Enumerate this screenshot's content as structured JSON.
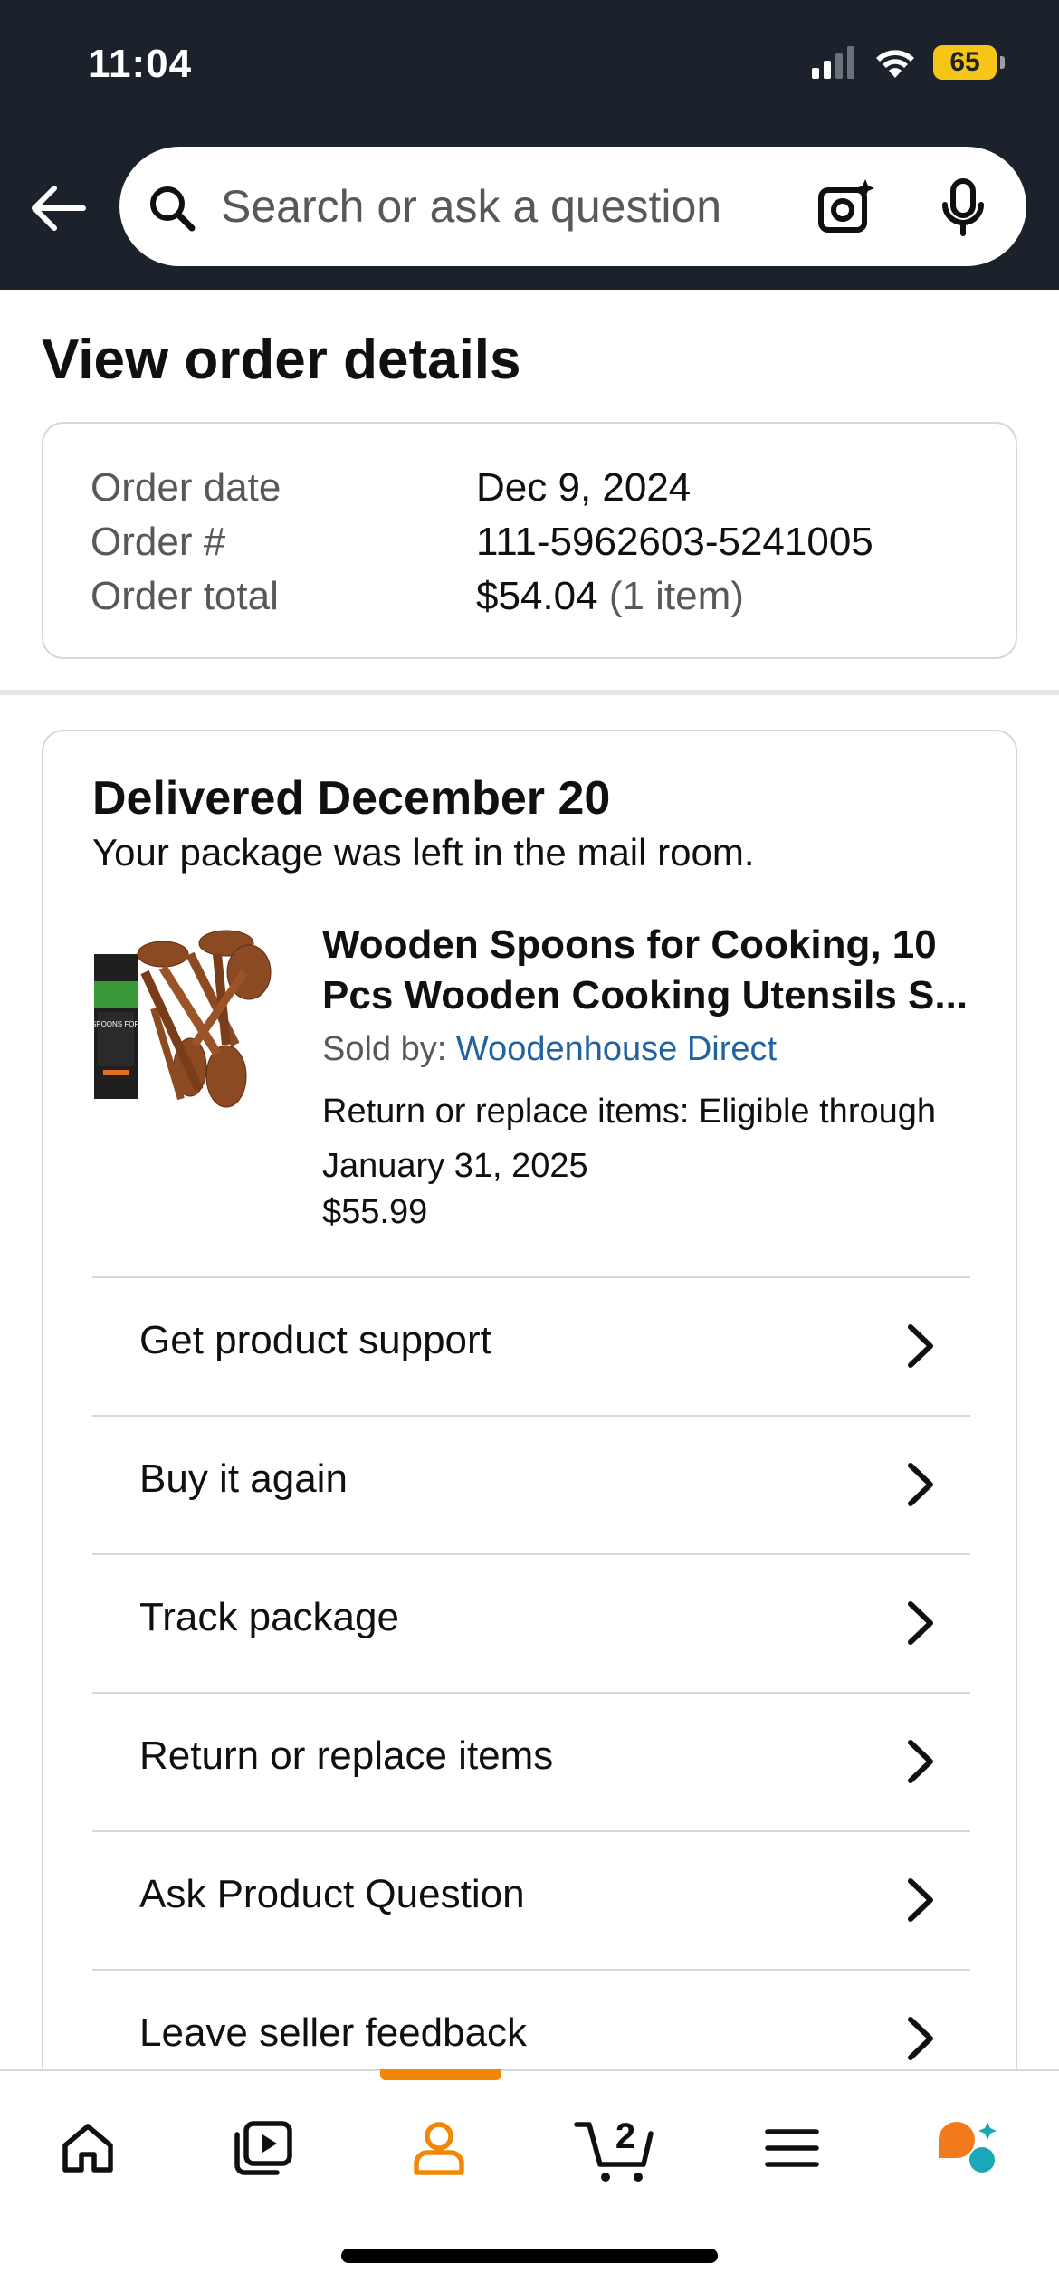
{
  "status_bar": {
    "time": "11:04",
    "battery": "65"
  },
  "search": {
    "placeholder": "Search or ask a question"
  },
  "page": {
    "title": "View order details"
  },
  "order_summary": {
    "rows": [
      {
        "label": "Order date",
        "value": "Dec 9, 2024",
        "extra": ""
      },
      {
        "label": "Order #",
        "value": "111-5962603-5241005",
        "extra": ""
      },
      {
        "label": "Order total",
        "value": "$54.04",
        "extra": "(1 item)"
      }
    ]
  },
  "shipment": {
    "status": "Delivered December 20",
    "note": "Your package was left in the mail room.",
    "item": {
      "title_line1": "Wooden Spoons for Cooking, 10",
      "title_line2": "Pcs Wooden Cooking Utensils S...",
      "sold_by_label": "Sold by:",
      "seller": "Woodenhouse Direct",
      "return_note": "Return or replace items: Eligible through January 31, 2025",
      "price": "$55.99",
      "thumb_text": "WOODEN SPOONS FOR COOKING"
    },
    "actions": [
      "Get product support",
      "Buy it again",
      "Track package",
      "Return or replace items",
      "Ask Product Question",
      "Leave seller feedback"
    ]
  },
  "bottom_nav": {
    "items": [
      "home-icon",
      "video-icon",
      "account-icon",
      "cart-icon",
      "menu-icon",
      "rufus-icon"
    ],
    "cart_count": "2",
    "active": "account-icon",
    "accent_color": "#f08804"
  }
}
